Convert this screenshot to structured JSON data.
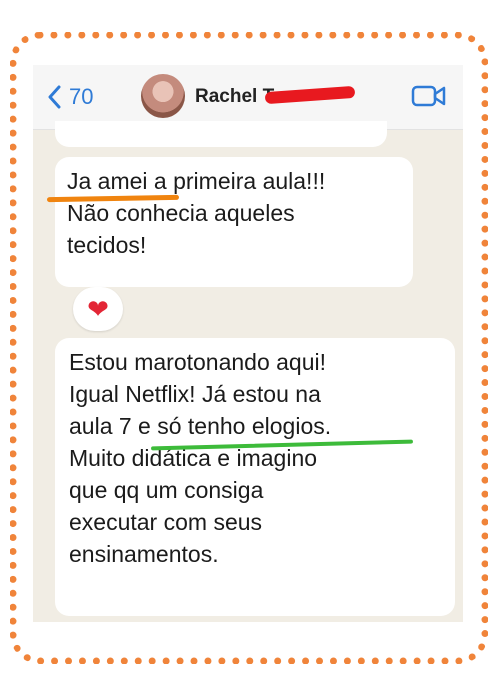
{
  "header": {
    "back_count": "70",
    "contact_name": "Rachel T"
  },
  "messages": [
    {
      "lines": [
        "Ja amei a primeira aula!!!",
        "Não conhecia aqueles",
        "tecidos!"
      ]
    },
    {
      "lines": [
        "Estou marotonando aqui!",
        "Igual Netflix! Já estou na",
        "aula 7 e só tenho elogios.",
        "Muito didática e imagino",
        "que qq um consiga",
        "executar com seus",
        "ensinamentos."
      ]
    }
  ],
  "reaction": {
    "emoji": "❤",
    "color": "#e32636"
  },
  "colors": {
    "frame": "#f0843a",
    "accent_blue": "#2f7bd6",
    "highlight_orange": "#f0840f",
    "highlight_green": "#3dbb3a",
    "redaction_red": "#e8191f"
  },
  "icons": [
    "chevron-left-icon",
    "video-call-icon",
    "heart-icon"
  ]
}
